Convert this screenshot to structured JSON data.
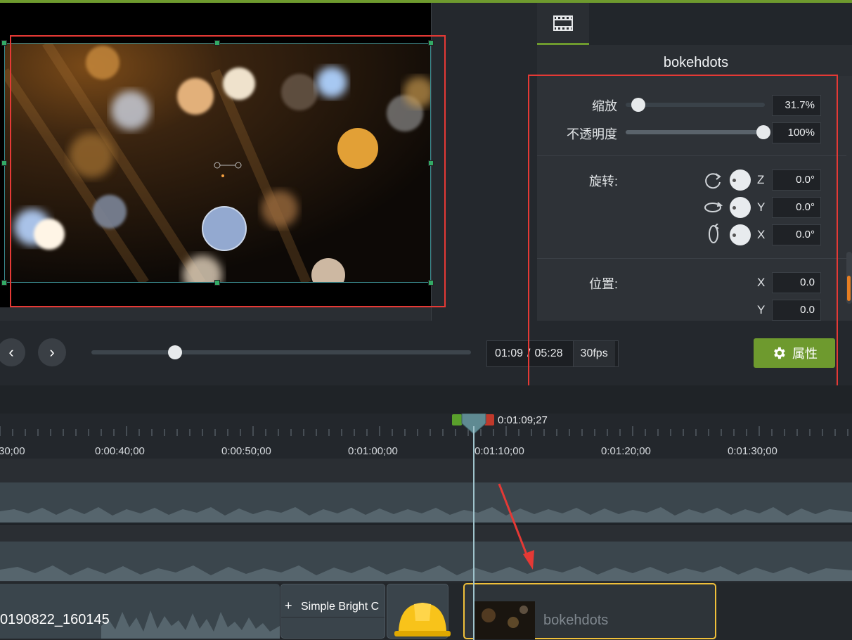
{
  "props_panel": {
    "title": "bokehdots",
    "scale_label": "缩放",
    "scale_value": "31.7%",
    "scale_fraction": 0.05,
    "opacity_label": "不透明度",
    "opacity_value": "100%",
    "opacity_fraction": 1.0,
    "rotation_label": "旋转:",
    "rotation": {
      "z_label": "Z",
      "z_value": "0.0°",
      "y_label": "Y",
      "y_value": "0.0°",
      "x_label": "X",
      "x_value": "0.0°"
    },
    "position_label": "位置:",
    "position": {
      "x_label": "X",
      "x_value": "0.0",
      "y_label": "Y",
      "y_value": "0.0"
    },
    "properties_button": "属性"
  },
  "transport": {
    "current_time": "01:09",
    "separator": "/",
    "duration": "05:28",
    "fps": "30fps",
    "scrub_fraction": 0.22
  },
  "timeline": {
    "playhead_time": "0:01:09;27",
    "ruler_labels": [
      "30;00",
      "0:00:40;00",
      "0:00:50;00",
      "0:01:00;00",
      "0:01:10;00",
      "0:01:20;00",
      "0:01:30;00"
    ],
    "clips": {
      "audio_clip_name": "0190822_160145",
      "transition_name": "Simple Bright C",
      "media_clip_name": "bokehdots"
    }
  },
  "colors": {
    "accent_green": "#6e9a2e",
    "annotation_red": "#e53935",
    "clip_selected_border": "#f0c03a"
  }
}
